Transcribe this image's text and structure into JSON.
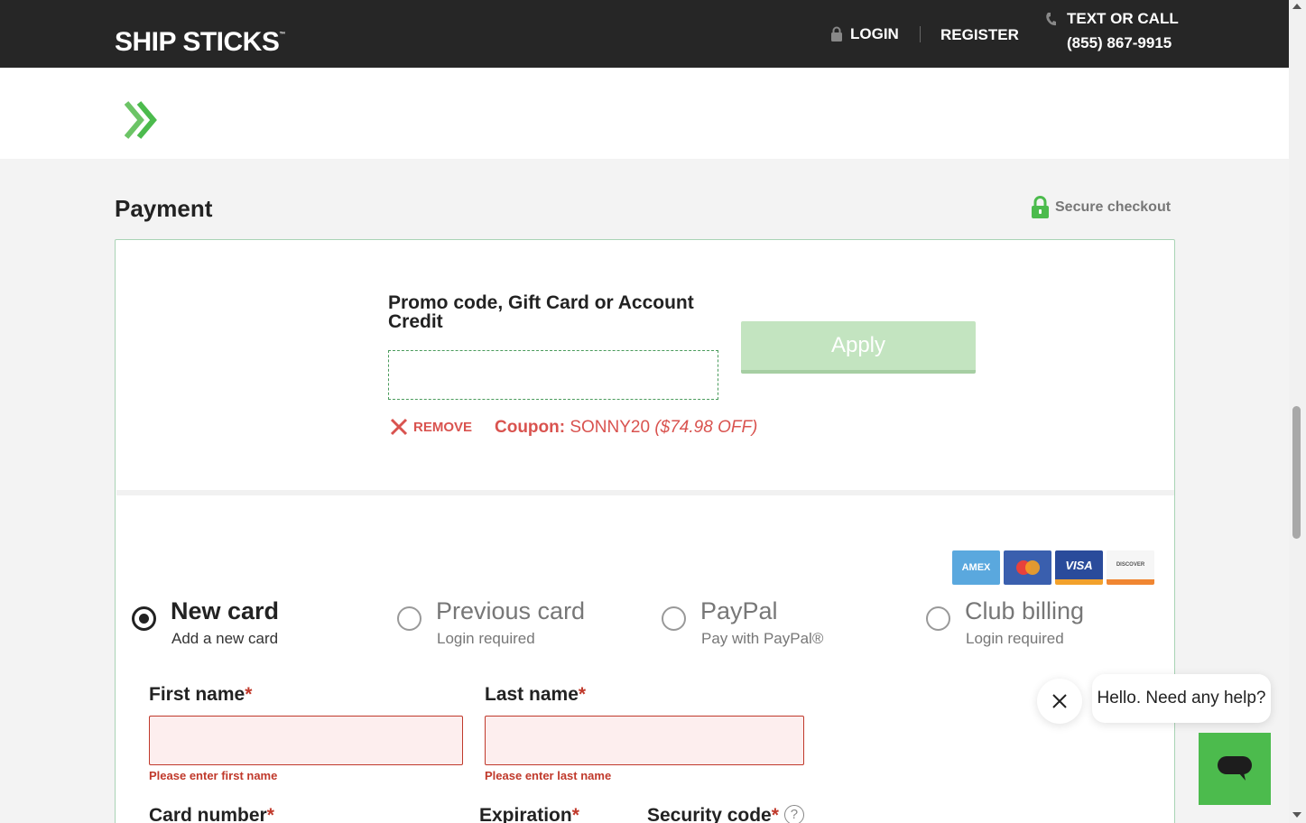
{
  "header": {
    "logo_text": "SHIP STICKS",
    "login_label": "LOGIN",
    "register_label": "REGISTER",
    "call_label": "TEXT OR CALL",
    "phone": "(855) 867-9915"
  },
  "payment": {
    "title": "Payment",
    "secure_label": "Secure checkout",
    "promo_label": "Promo code, Gift Card or Account Credit",
    "promo_value": "",
    "apply_label": "Apply",
    "remove_label": "REMOVE",
    "coupon_prefix": "Coupon:",
    "coupon_code": "SONNY20",
    "coupon_discount": "($74.98 OFF)"
  },
  "brands": {
    "amex": "AMEX",
    "visa": "VISA",
    "discover": "DISCOVER"
  },
  "options": [
    {
      "title": "New card",
      "subtitle": "Add a new card",
      "selected": true
    },
    {
      "title": "Previous card",
      "subtitle": "Login required",
      "selected": false
    },
    {
      "title": "PayPal",
      "subtitle": "Pay with PayPal®",
      "selected": false
    },
    {
      "title": "Club billing",
      "subtitle": "Login required",
      "selected": false
    }
  ],
  "form": {
    "first_name_label": "First name",
    "last_name_label": "Last name",
    "first_name_error": "Please enter first name",
    "last_name_error": "Please enter last name",
    "card_number_label": "Card number",
    "expiration_label": "Expiration",
    "security_code_label": "Security code",
    "required_mark": "*",
    "help_mark": "?"
  },
  "chat": {
    "message": "Hello. Need any help?"
  },
  "colors": {
    "header_bg": "#262626",
    "brand_green": "#4cbb4d",
    "error_red": "#c0392b",
    "coupon_red": "#d9534f"
  }
}
